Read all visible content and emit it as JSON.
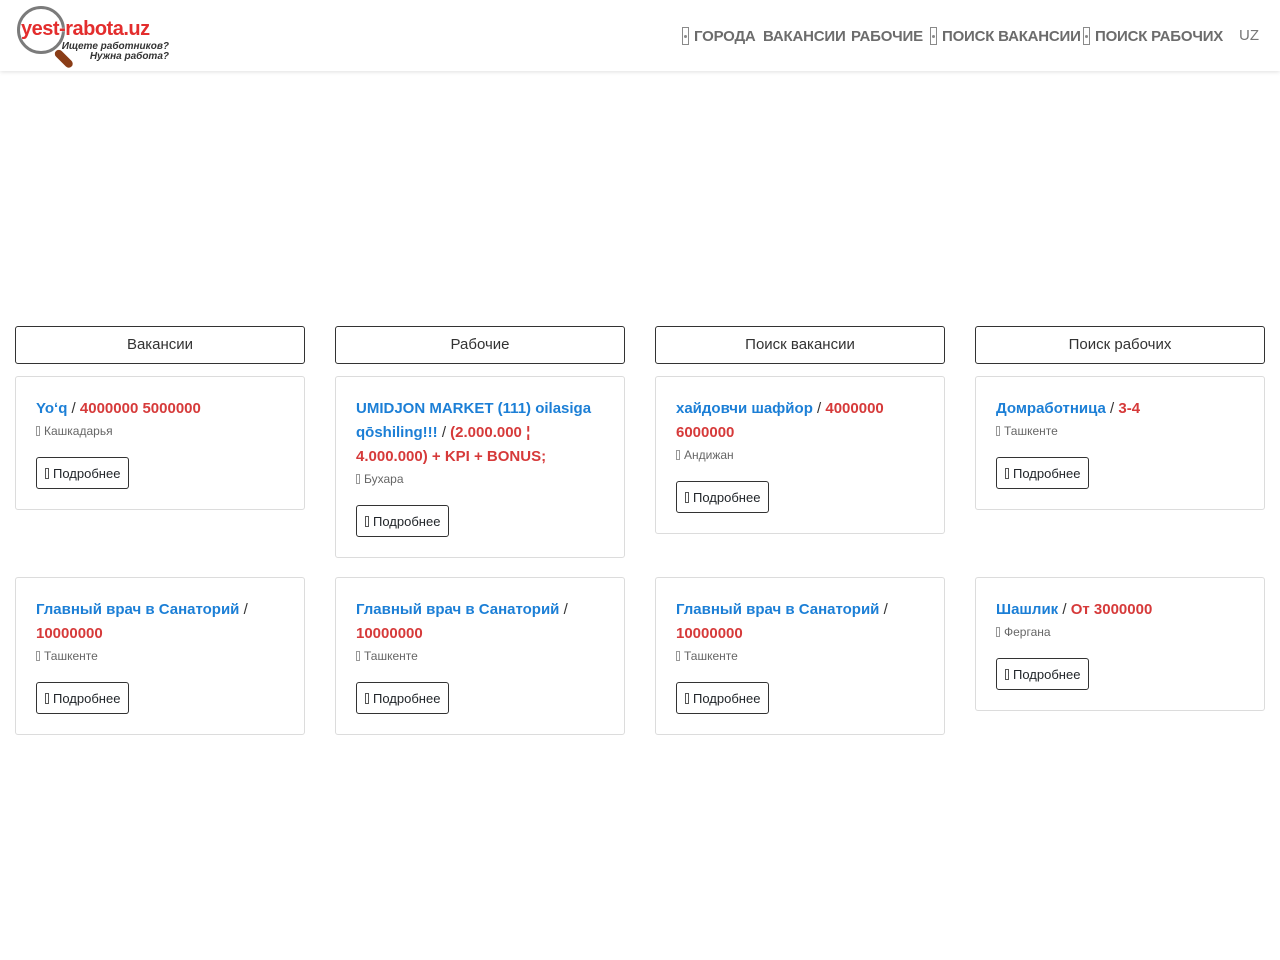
{
  "logo": {
    "title": "yest-rabota.uz",
    "line1": "Ищете работников?",
    "line2": "Нужна работа?"
  },
  "nav": {
    "cities": "Города",
    "vacancies": "Вакансии",
    "workers": "Рабочие",
    "search_vacancies": "Поиск вакансии",
    "search_workers": "Поиск рабочих",
    "lang": "UZ"
  },
  "columns": [
    {
      "header": "Вакансии",
      "cards": [
        {
          "name": "Yoʻq",
          "sep": " / ",
          "salary": "4000000 5000000",
          "location": "Кашкадарья",
          "button": "Подробнее"
        },
        {
          "name": "Главный врач в Санаторий",
          "sep": " / ",
          "salary": "10000000",
          "location": "Ташкенте",
          "button": "Подробнее"
        }
      ]
    },
    {
      "header": "Рабочие",
      "cards": [
        {
          "name": "UMIDJON MARKET (111) oilasiga qōshiling!!!",
          "sep": " / ",
          "salary": "(2.000.000 ¦ 4.000.000) + KPI + BONUS;",
          "location": "Бухара",
          "button": "Подробнее"
        },
        {
          "name": "Главный врач в Санаторий",
          "sep": " / ",
          "salary": "10000000",
          "location": "Ташкенте",
          "button": "Подробнее"
        }
      ]
    },
    {
      "header": "Поиск вакансии",
      "cards": [
        {
          "name": "хайдовчи шафйор",
          "sep": " / ",
          "salary": "4000000 6000000",
          "location": "Андижан",
          "button": "Подробнее"
        },
        {
          "name": "Главный врач в Санаторий",
          "sep": " / ",
          "salary": "10000000",
          "location": "Ташкенте",
          "button": "Подробнее"
        }
      ]
    },
    {
      "header": "Поиск рабочих",
      "cards": [
        {
          "name": "Домработница",
          "sep": " / ",
          "salary": "3-4",
          "location": "Ташкенте",
          "button": "Подробнее"
        },
        {
          "name": "Шашлик",
          "sep": " / ",
          "salary": "От 3000000",
          "location": "Фергана",
          "button": "Подробнее"
        }
      ]
    }
  ],
  "colors": {
    "link": "#1c7fd6",
    "salary": "#d63a3a",
    "logo_red": "#e32d2d"
  }
}
